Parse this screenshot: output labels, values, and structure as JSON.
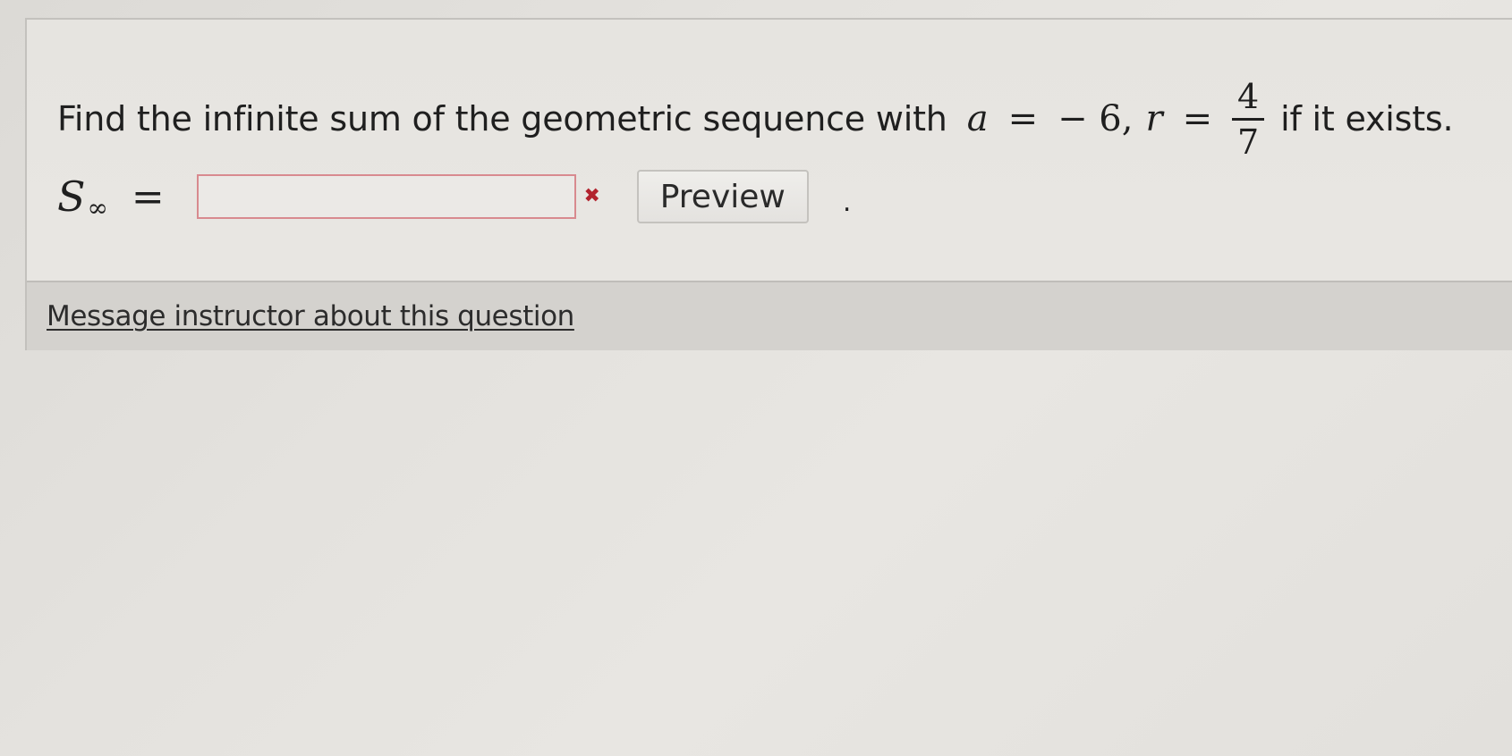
{
  "question": {
    "prompt_prefix": "Find the infinite sum of the geometric sequence with",
    "var_a": "a",
    "equals": "=",
    "a_value": "− 6,",
    "var_r": "r",
    "r_numerator": "4",
    "r_denominator": "7",
    "prompt_suffix": "if it exists."
  },
  "answer": {
    "symbol": "S",
    "subscript": "∞",
    "equals": "=",
    "input_value": "",
    "input_placeholder": "",
    "status_icon": "error-x-icon",
    "status_glyph": "✖",
    "preview_label": "Preview",
    "trailing_punct": "."
  },
  "footer": {
    "message_link": "Message instructor about this question"
  },
  "colors": {
    "input_border_error": "#d88a8f",
    "error_icon": "#b2232e",
    "footer_bg": "#d4d2ce"
  }
}
